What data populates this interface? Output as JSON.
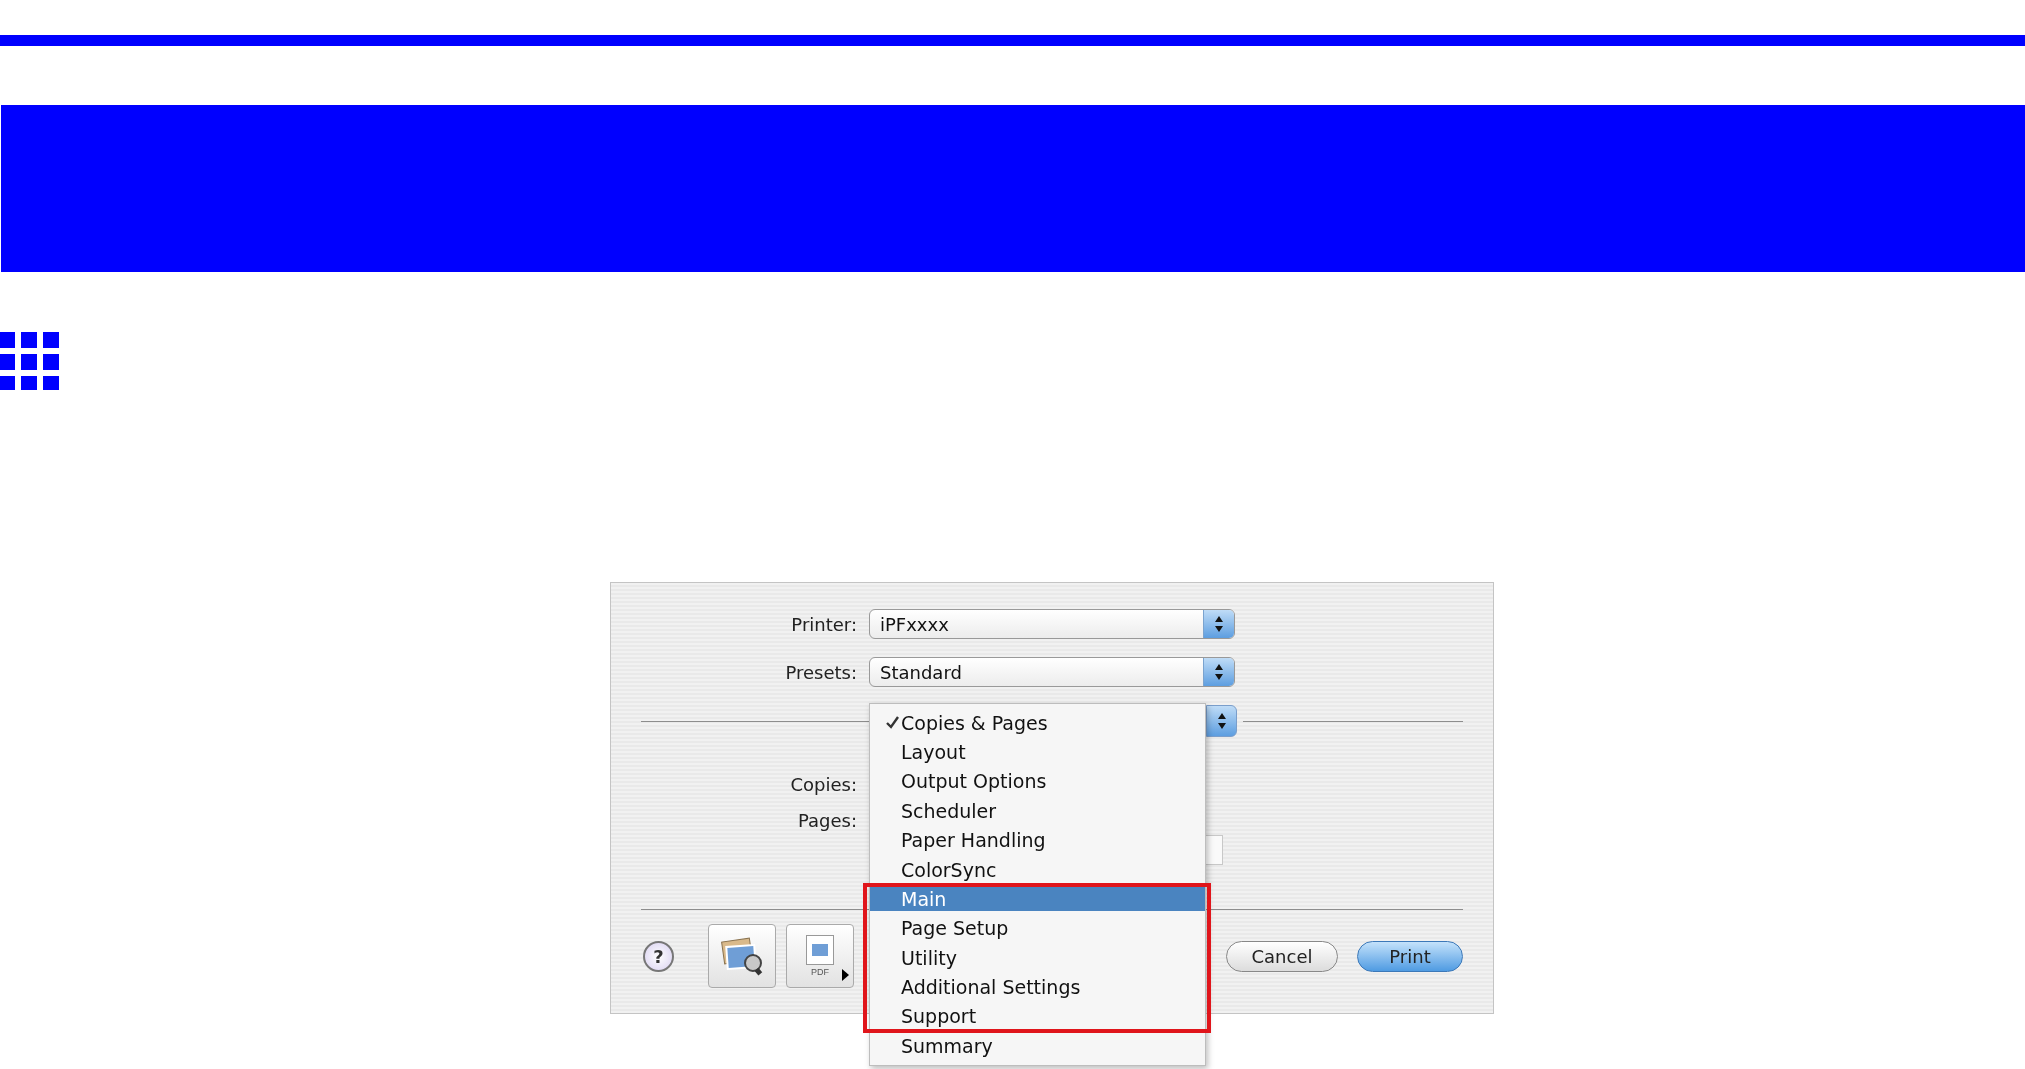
{
  "printer": {
    "label": "Printer:",
    "value": "iPFxxxx"
  },
  "presets": {
    "label": "Presets:",
    "value": "Standard"
  },
  "copies": {
    "label": "Copies:"
  },
  "pages": {
    "label": "Pages:"
  },
  "menu": {
    "items": [
      {
        "label": "Copies & Pages",
        "checked": true,
        "selected": false
      },
      {
        "label": "Layout",
        "checked": false,
        "selected": false
      },
      {
        "label": "Output Options",
        "checked": false,
        "selected": false
      },
      {
        "label": "Scheduler",
        "checked": false,
        "selected": false
      },
      {
        "label": "Paper Handling",
        "checked": false,
        "selected": false
      },
      {
        "label": "ColorSync",
        "checked": false,
        "selected": false
      },
      {
        "label": "Main",
        "checked": false,
        "selected": true
      },
      {
        "label": "Page Setup",
        "checked": false,
        "selected": false
      },
      {
        "label": "Utility",
        "checked": false,
        "selected": false
      },
      {
        "label": "Additional Settings",
        "checked": false,
        "selected": false
      },
      {
        "label": "Support",
        "checked": false,
        "selected": false
      },
      {
        "label": "Summary",
        "checked": false,
        "selected": false
      }
    ]
  },
  "help_button": {
    "label": "?"
  },
  "pdf_button": {
    "label": "PDF"
  },
  "buttons": [
    {
      "label": "Cancel",
      "default": false
    },
    {
      "label": "Print",
      "default": true
    }
  ]
}
